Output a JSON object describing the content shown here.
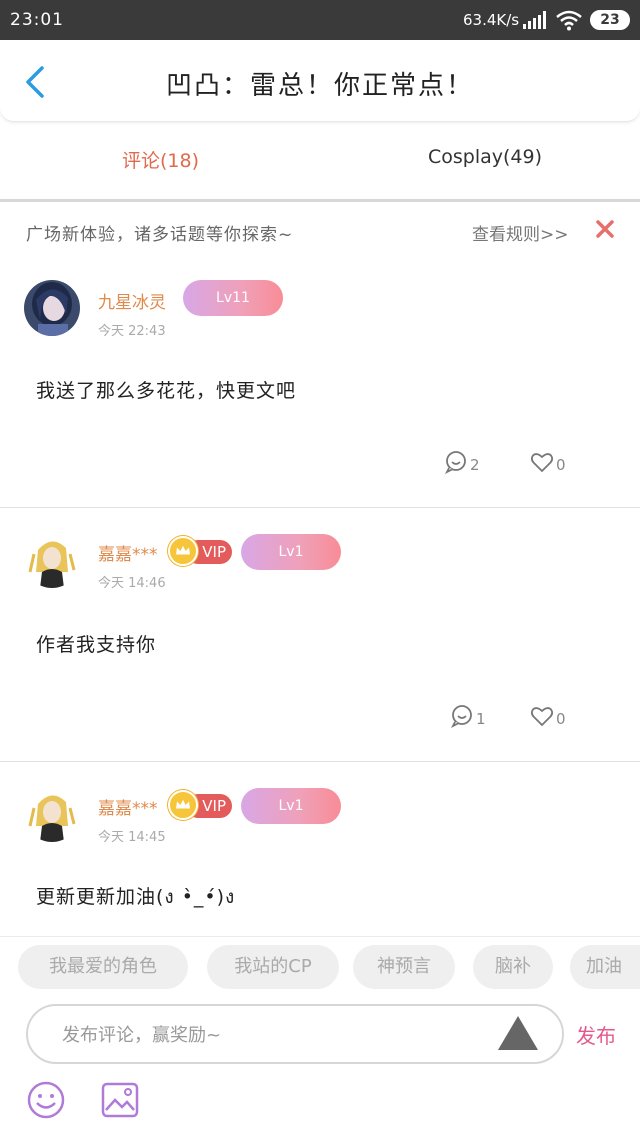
{
  "status_bar": {
    "time": "23:01",
    "speed": "63.4K/s",
    "battery": "23"
  },
  "header": {
    "title": "凹凸：雷总！你正常点！"
  },
  "tabs": [
    {
      "label": "评论(18)",
      "active": true
    },
    {
      "label": "Cosplay(49)",
      "active": false
    }
  ],
  "notice": {
    "text": "广场新体验，诸多话题等你探索~",
    "rules_link": "查看规则>>"
  },
  "comments": [
    {
      "user": "九星冰灵",
      "vip": false,
      "level": "Lv11",
      "time": "今天 22:43",
      "text": "我送了那么多花花，快更文吧",
      "replies": "2",
      "likes": "0"
    },
    {
      "user": "嘉嘉***",
      "vip": true,
      "vip_label": "VIP",
      "level": "Lv1",
      "time": "今天 14:46",
      "text": "作者我支持你",
      "replies": "1",
      "likes": "0"
    },
    {
      "user": "嘉嘉***",
      "vip": true,
      "vip_label": "VIP",
      "level": "Lv1",
      "time": "今天 14:45",
      "text": "更新更新加油(ง •̀_•́)ง"
    }
  ],
  "topic_chips": [
    "我最爱的角色",
    "我站的CP",
    "神预言",
    "脑补",
    "加油"
  ],
  "composer": {
    "placeholder": "发布评论，赢奖励~",
    "publish_label": "发布"
  },
  "colors": {
    "accent_tab": "#e06a4e",
    "username": "#e0894a",
    "vip_red": "#e35b5b",
    "publish": "#e35b8c",
    "back_arrow": "#2d9be0"
  }
}
